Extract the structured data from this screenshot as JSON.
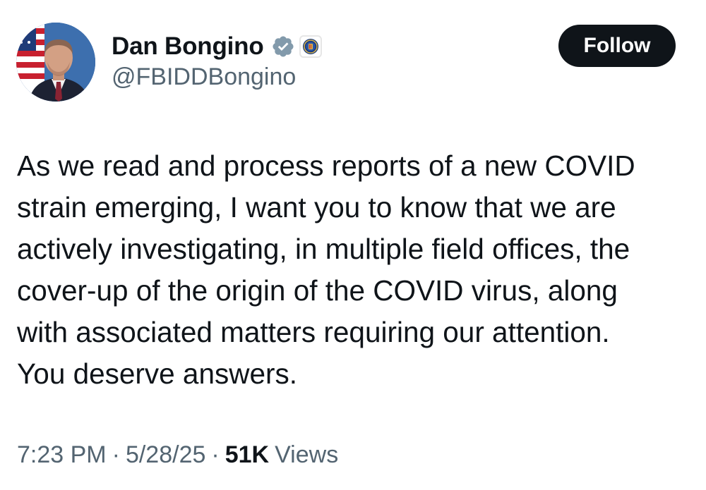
{
  "author": {
    "display_name": "Dan Bongino",
    "handle": "@FBIDDBongino",
    "avatar_icon": "profile-photo",
    "verified_icon": "verified-badge-icon",
    "affiliate_icon": "fbi-seal-icon"
  },
  "follow_button": {
    "label": "Follow"
  },
  "tweet": {
    "lines": [
      "As we read and process reports of a new COVID",
      "strain emerging, I want you to know that we are",
      "actively investigating, in multiple field offices, the",
      "cover-up of the origin of the COVID virus, along",
      "with associated matters requiring our attention.",
      "You deserve answers."
    ]
  },
  "meta": {
    "time": "7:23 PM",
    "separator": "·",
    "date": "5/28/25",
    "views_count": "51K",
    "views_label": "Views"
  },
  "colors": {
    "text_primary": "#0f1419",
    "text_secondary": "#536471",
    "verified_badge": "#829aab",
    "button_bg": "#0f1419"
  }
}
